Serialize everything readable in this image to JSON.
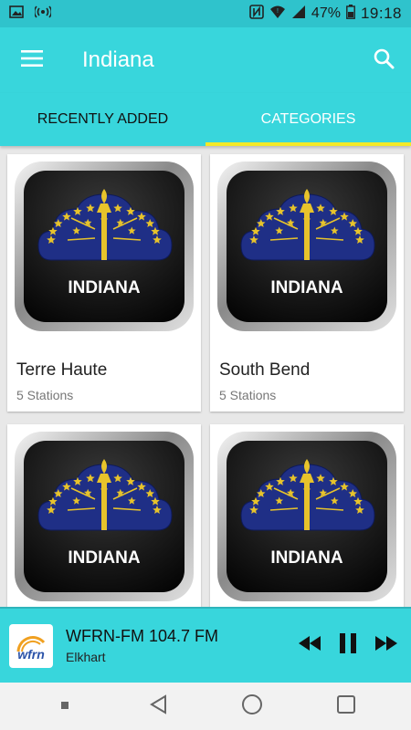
{
  "status_bar": {
    "battery": "47%",
    "time": "19:18",
    "icons": [
      "image-icon",
      "broadcast-icon",
      "nfc-icon",
      "wifi-icon",
      "signal-icon",
      "battery-icon"
    ]
  },
  "app_bar": {
    "title": "Indiana",
    "menu_icon": "hamburger-menu-icon",
    "search_icon": "search-icon"
  },
  "tabs": [
    {
      "label": "RECENTLY ADDED",
      "active": false
    },
    {
      "label": "CATEGORIES",
      "active": true
    }
  ],
  "cards": [
    {
      "thumb_label": "INDIANA",
      "name": "Terre Haute",
      "count": "5 Stations"
    },
    {
      "thumb_label": "INDIANA",
      "name": "South Bend",
      "count": "5 Stations"
    },
    {
      "thumb_label": "INDIANA",
      "name": "",
      "count": ""
    },
    {
      "thumb_label": "INDIANA",
      "name": "",
      "count": ""
    }
  ],
  "player": {
    "logo_text": "wfrn",
    "station_name": "WFRN-FM 104.7 FM",
    "station_city": "Elkhart",
    "controls": [
      "rewind-icon",
      "pause-icon",
      "fast-forward-icon"
    ]
  },
  "colors": {
    "primary": "#38d6dc",
    "status_bar": "#2fc3cc",
    "tab_indicator": "#f3e928",
    "flag_blue": "#1f2f86",
    "flag_gold": "#e7c32b"
  }
}
